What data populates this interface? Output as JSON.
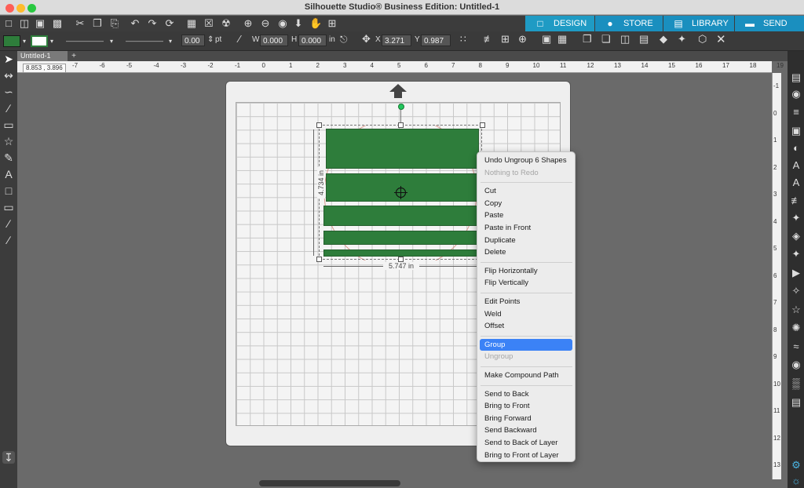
{
  "window": {
    "title": "Silhouette Studio® Business Edition: Untitled-1"
  },
  "modes": [
    "DESIGN",
    "STORE",
    "LIBRARY",
    "SEND"
  ],
  "toolbar": {
    "stroke_width": "0.00",
    "stroke_unit": "pt",
    "w_label": "W",
    "w_value": "0.000",
    "h_label": "H",
    "h_value": "0.000",
    "size_unit": "in",
    "x_label": "X",
    "x_value": "3.271",
    "y_label": "Y",
    "y_value": "0.987"
  },
  "document": {
    "tab_name": "Untitled-1",
    "add_tab": "+"
  },
  "rulers": {
    "cursor": "8.853 , 3.896",
    "h_ticks": [
      "-7",
      "-6",
      "-5",
      "-4",
      "-3",
      "-2",
      "-1",
      "0",
      "1",
      "2",
      "3",
      "4",
      "5",
      "6",
      "7",
      "8",
      "9",
      "10",
      "11",
      "12",
      "13",
      "14",
      "15",
      "16",
      "17",
      "18",
      "19"
    ],
    "v_ticks": [
      "-1",
      "0",
      "1",
      "2",
      "3",
      "4",
      "5",
      "6",
      "7",
      "8",
      "9",
      "10",
      "11",
      "12",
      "13"
    ]
  },
  "selection": {
    "width": "5.747 in",
    "height": "4.734 in"
  },
  "context_menu": [
    {
      "label": "Undo Ungroup 6 Shapes"
    },
    {
      "label": "Nothing to Redo",
      "disabled": true
    },
    {
      "separator": true
    },
    {
      "label": "Cut"
    },
    {
      "label": "Copy"
    },
    {
      "label": "Paste"
    },
    {
      "label": "Paste in Front"
    },
    {
      "label": "Duplicate"
    },
    {
      "label": "Delete"
    },
    {
      "separator": true
    },
    {
      "label": "Flip Horizontally"
    },
    {
      "label": "Flip Vertically"
    },
    {
      "separator": true
    },
    {
      "label": "Edit Points"
    },
    {
      "label": "Weld"
    },
    {
      "label": "Offset"
    },
    {
      "separator": true
    },
    {
      "label": "Group",
      "highlighted": true
    },
    {
      "label": "Ungroup",
      "disabled": true
    },
    {
      "separator": true
    },
    {
      "label": "Make Compound Path"
    },
    {
      "separator": true
    },
    {
      "label": "Send to Back"
    },
    {
      "label": "Bring to Front"
    },
    {
      "label": "Bring Forward"
    },
    {
      "label": "Send Backward"
    },
    {
      "label": "Send to Back of Layer"
    },
    {
      "label": "Bring to Front of Layer"
    }
  ],
  "colors": {
    "fill": "#2e7d3b",
    "highlight": "#3b82f6",
    "mode_active": "#1f9bc4",
    "mode_bg": "#1a8fbf"
  }
}
